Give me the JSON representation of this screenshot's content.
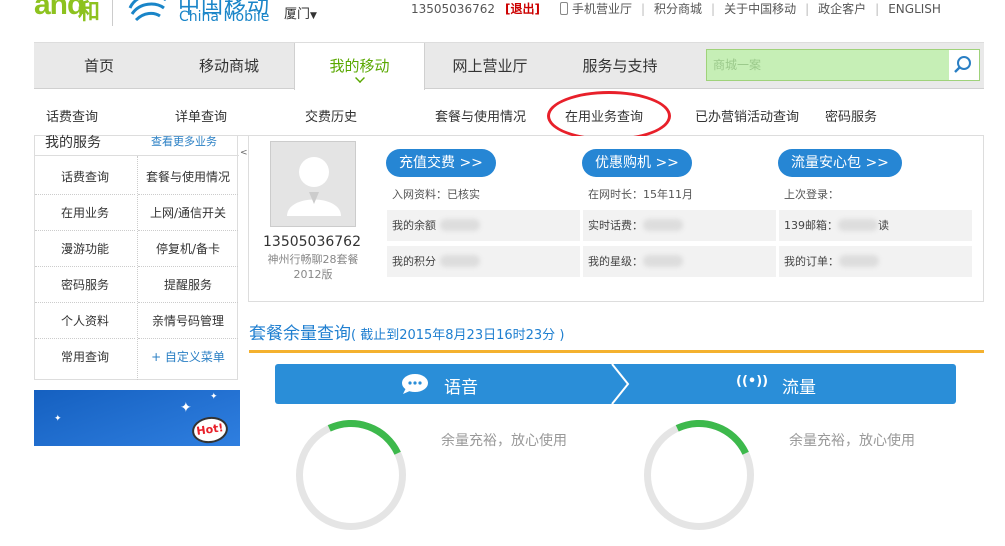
{
  "header": {
    "logo_and": "and",
    "logo_he": "和",
    "brand_cn": "中国移动",
    "brand_en": "China Mobile",
    "city": "厦门",
    "phone": "13505036762",
    "logout": "[退出]",
    "links": [
      "手机营业厅",
      "积分商城",
      "关于中国移动",
      "政企客户",
      "ENGLISH"
    ]
  },
  "nav": {
    "tabs": [
      "首页",
      "移动商城",
      "我的移动",
      "网上营业厅",
      "服务与支持"
    ],
    "active": "我的移动",
    "search_placeholder": "商城一案"
  },
  "subnav": [
    "话费查询",
    "详单查询",
    "交费历史",
    "套餐与使用情况",
    "在用业务查询",
    "已办营销活动查询",
    "密码服务"
  ],
  "sidebar": {
    "title": "我的服务",
    "more": "查看更多业务",
    "items": [
      "话费查询",
      "套餐与使用情况",
      "在用业务",
      "上网/通信开关",
      "漫游功能",
      "停复机/备卡",
      "密码服务",
      "提醒服务",
      "个人资料",
      "亲情号码管理",
      "常用查询",
      "+ 自定义菜单"
    ],
    "collapse": "<",
    "banner_hot": "Hot!"
  },
  "user": {
    "number": "13505036762",
    "plan": "神州行畅聊28套餐2012版",
    "actions": [
      "充值交费 >>",
      "优惠购机 >>",
      "流量安心包 >>"
    ],
    "meta": [
      "入网资料：已核实",
      "在网时长：15年11月",
      "上次登录："
    ],
    "row1": [
      "我的余额",
      "实时话费：",
      "139邮箱：",
      "读"
    ],
    "row2": [
      "我的积分",
      "我的星级：",
      "我的订单："
    ]
  },
  "balance": {
    "title": "套餐余量查询",
    "subtitle": "( 截止到2015年8月23日16时23分 )",
    "tabs": [
      "语音",
      "流量"
    ],
    "gauge_text": "余量充裕，放心使用"
  }
}
